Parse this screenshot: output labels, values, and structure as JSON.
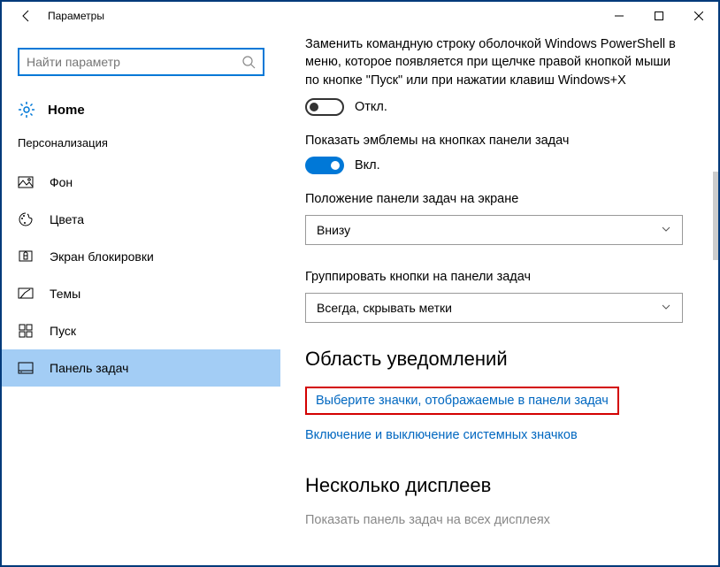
{
  "titlebar": {
    "title": "Параметры"
  },
  "search": {
    "placeholder": "Найти параметр"
  },
  "home": {
    "label": "Home"
  },
  "section": {
    "label": "Персонализация"
  },
  "nav": {
    "items": [
      {
        "label": "Фон"
      },
      {
        "label": "Цвета"
      },
      {
        "label": "Экран блокировки"
      },
      {
        "label": "Темы"
      },
      {
        "label": "Пуск"
      },
      {
        "label": "Панель задач"
      }
    ]
  },
  "main": {
    "powershell_desc": "Заменить командную строку оболочкой Windows PowerShell в меню, которое появляется при щелчке правой кнопкой мыши по кнопке \"Пуск\" или при нажатии клавиш Windows+X",
    "toggle_off": "Откл.",
    "badges_label": "Показать эмблемы на кнопках панели задач",
    "toggle_on": "Вкл.",
    "position_label": "Положение панели задач на экране",
    "position_value": "Внизу",
    "group_label": "Группировать кнопки на панели задач",
    "group_value": "Всегда, скрывать метки",
    "notif_head": "Область уведомлений",
    "link_select_icons": "Выберите значки, отображаемые в панели задач",
    "link_system_icons": "Включение и выключение системных значков",
    "multi_head": "Несколько дисплеев",
    "multi_desc": "Показать панель задач на всех дисплеях"
  }
}
